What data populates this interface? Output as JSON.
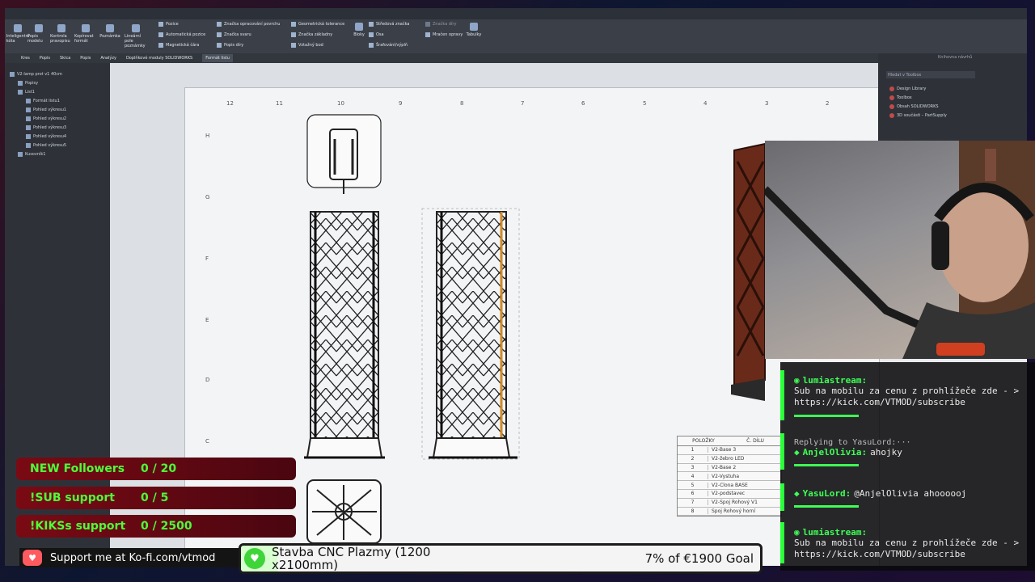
{
  "ribbon": {
    "buttons": [
      "Inteligentní kóta",
      "Popis modelu",
      "Kontrola pravopisu",
      "Kopírovat formát",
      "Poznámka",
      "Lineární pole poznámky"
    ],
    "small": [
      "Pozice",
      "Automatická pozice",
      "Magnetická čára",
      "Značka opracování povrchu",
      "Značka svaru",
      "Popis díry",
      "Geometrická tolerance",
      "Značka základny",
      "Vztažný bod",
      "Středová značka",
      "Osa",
      "Šrafování/výplň",
      "Značka díry",
      "Mračen opravy",
      "Tabulky",
      "Bloky"
    ]
  },
  "cmdtabs": [
    "Kres",
    "Popis",
    "Skica",
    "Popis",
    "Analýzy",
    "Doplňkové moduly SOLIDWORKS",
    "Formát listu"
  ],
  "tree": {
    "items": [
      "V2-lamp prot v1 40cm",
      "Popisy",
      "List1",
      "Formát listu1",
      "Pohled výkresu1",
      "Pohled výkresu2",
      "Pohled výkresu3",
      "Pohled výkresu4",
      "Pohled výkresu5",
      "Kusovník1"
    ]
  },
  "taskpane": {
    "search": "Hledat v Toolbox",
    "items": [
      "Design Library",
      "Toolbox",
      "Obsah SOLIDWORKS",
      "3D součásti – PartSupply"
    ],
    "title": "Knihovna návrhů"
  },
  "rulers": {
    "top": [
      "12",
      "11",
      "10",
      "9",
      "8",
      "7",
      "6",
      "5",
      "4",
      "3",
      "2"
    ],
    "left": [
      "H",
      "G",
      "F",
      "E",
      "D",
      "C"
    ]
  },
  "bom": {
    "headers": [
      "POLOŽKY",
      "Č. DÍLU"
    ],
    "rows": [
      {
        "n": "1",
        "p": "V2-Base 3"
      },
      {
        "n": "2",
        "p": "V2-žebro LED"
      },
      {
        "n": "3",
        "p": "V2-Base 2"
      },
      {
        "n": "4",
        "p": "V2-Vystuha"
      },
      {
        "n": "5",
        "p": "V2-Clona BASE"
      },
      {
        "n": "6",
        "p": "V2-podstavec"
      },
      {
        "n": "7",
        "p": "V2-Spoj Rohový V1"
      },
      {
        "n": "8",
        "p": "Spoj Rohový horní"
      }
    ]
  },
  "chat": [
    {
      "user": "lumiastream:",
      "body": "Sub na mobilu za cenu z prohlížeče zde - > https://kick.com/VTMOD/subscribe"
    },
    {
      "reply": "Replying to YasuLord:···",
      "user": "AnjelOlivia:",
      "body": "ahojky"
    },
    {
      "user": "YasuLord:",
      "body": "@AnjelOlivia ahoooooj"
    },
    {
      "user": "lumiastream:",
      "body": "Sub na mobilu za cenu z prohlížeče zde - > https://kick.com/VTMOD/subscribe"
    }
  ],
  "goals": [
    {
      "label": "NEW Followers",
      "value": "0 / 20"
    },
    {
      "label": "!SUB support",
      "value": "0 / 5"
    },
    {
      "label": "!KIKSs support",
      "value": "0 / 2500"
    }
  ],
  "kofi": {
    "text": "Support me at Ko-fi.com/vtmod"
  },
  "donation": {
    "title": "Stavba CNC Plazmy (1200 x2100mm)",
    "progress": "7% of €1900 Goal",
    "fraction": 0.07
  },
  "colors": {
    "accent": "#3fff56",
    "goal_bg": "#7a0a14",
    "kofi": "#ff5a5f"
  }
}
